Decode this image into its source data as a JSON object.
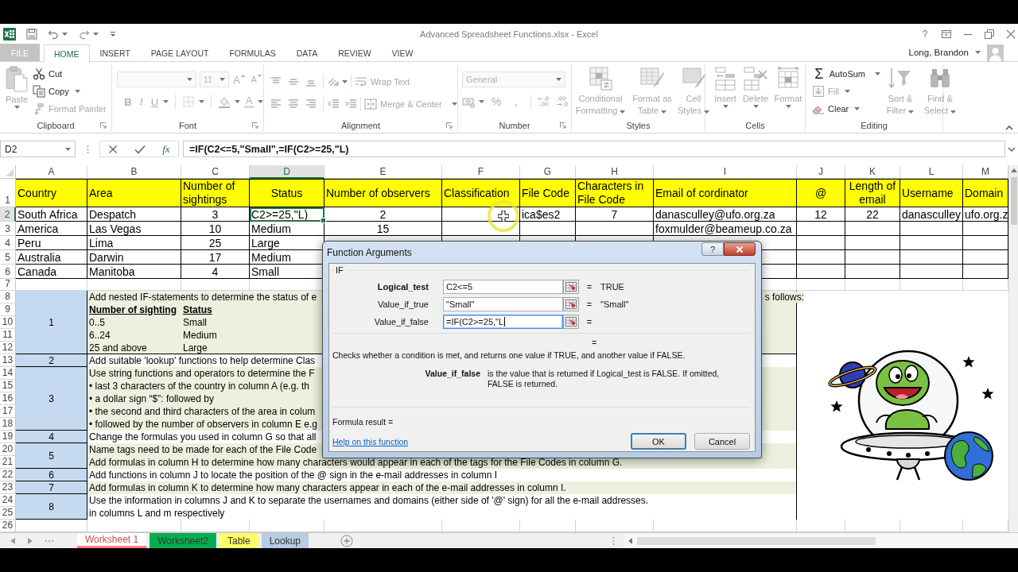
{
  "window": {
    "title": "Advanced Spreadsheet Functions.xlsx - Excel",
    "help": "?",
    "user": "Long, Brandon"
  },
  "ribbon_tabs": [
    {
      "label": "FILE",
      "kind": "file",
      "selected": false
    },
    {
      "label": "HOME",
      "kind": "tab",
      "selected": true
    },
    {
      "label": "INSERT",
      "kind": "tab",
      "selected": false
    },
    {
      "label": "PAGE LAYOUT",
      "kind": "tab",
      "selected": false
    },
    {
      "label": "FORMULAS",
      "kind": "tab",
      "selected": false
    },
    {
      "label": "DATA",
      "kind": "tab",
      "selected": false
    },
    {
      "label": "REVIEW",
      "kind": "tab",
      "selected": false
    },
    {
      "label": "VIEW",
      "kind": "tab",
      "selected": false
    }
  ],
  "ribbon_groups": [
    {
      "label": "Clipboard",
      "commands": [
        {
          "label": "Paste",
          "disabled": true
        },
        {
          "label": "Cut",
          "disabled": false
        },
        {
          "label": "Copy",
          "disabled": false
        },
        {
          "label": "Format Painter",
          "disabled": true
        }
      ]
    },
    {
      "label": "Font",
      "disabled": true,
      "font_size": "11",
      "letter_buttons": [
        {
          "kind": "grow",
          "label": "A"
        },
        {
          "kind": "shrink",
          "label": "A"
        },
        {
          "kind": "bold",
          "label": "B"
        },
        {
          "kind": "italic",
          "label": "I"
        },
        {
          "kind": "underline",
          "label": "U"
        },
        {
          "kind": "color",
          "label": "A"
        }
      ]
    },
    {
      "label": "Alignment",
      "disabled": true,
      "commands": [
        {
          "label": "Wrap Text",
          "disabled": true
        },
        {
          "label": "Merge & Center",
          "disabled": true
        }
      ]
    },
    {
      "label": "Number",
      "disabled": true,
      "format": "General",
      "symbols": [
        "%",
        ","
      ]
    },
    {
      "label": "Styles",
      "commands": [
        {
          "label": "Conditional Formatting",
          "disabled": true
        },
        {
          "label": "Format as Table",
          "disabled": true
        },
        {
          "label": "Cell Styles",
          "disabled": true
        }
      ]
    },
    {
      "label": "Cells",
      "commands": [
        {
          "label": "Insert",
          "disabled": true
        },
        {
          "label": "Delete",
          "disabled": true
        },
        {
          "label": "Format",
          "disabled": true
        }
      ]
    },
    {
      "label": "Editing",
      "commands": [
        {
          "label": "AutoSum",
          "symbol": "Σ",
          "disabled": false
        },
        {
          "label": "Fill",
          "disabled": true
        },
        {
          "label": "Clear",
          "disabled": false
        },
        {
          "label": "Sort & Filter",
          "disabled": true
        },
        {
          "label": "Find & Select",
          "disabled": true
        }
      ]
    }
  ],
  "formula_bar": {
    "name_box": "D2",
    "function_button": "fx",
    "formula": "=IF(C2<=5,\"Small\",=IF(C2>=25,\"L)"
  },
  "columns": [
    {
      "label": "A",
      "selected": false
    },
    {
      "label": "B",
      "selected": false
    },
    {
      "label": "C",
      "selected": false
    },
    {
      "label": "D",
      "selected": true
    },
    {
      "label": "E",
      "selected": false
    },
    {
      "label": "F",
      "selected": false
    },
    {
      "label": "G",
      "selected": false
    },
    {
      "label": "H",
      "selected": false
    },
    {
      "label": "I",
      "selected": false
    },
    {
      "label": "J",
      "selected": false
    },
    {
      "label": "K",
      "selected": false
    },
    {
      "label": "L",
      "selected": false
    },
    {
      "label": "M",
      "selected": false
    }
  ],
  "row_numbers": [
    {
      "label": "1",
      "selected": false
    },
    {
      "label": "2",
      "selected": true
    },
    {
      "label": "3",
      "selected": false
    },
    {
      "label": "4",
      "selected": false
    },
    {
      "label": "5",
      "selected": false
    },
    {
      "label": "6",
      "selected": false
    },
    {
      "label": "7",
      "selected": false
    },
    {
      "label": "8",
      "selected": false
    },
    {
      "label": "9",
      "selected": false
    },
    {
      "label": "10",
      "selected": false
    },
    {
      "label": "11",
      "selected": false
    },
    {
      "label": "12",
      "selected": false
    },
    {
      "label": "13",
      "selected": false
    },
    {
      "label": "14",
      "selected": false
    },
    {
      "label": "15",
      "selected": false
    },
    {
      "label": "16",
      "selected": false
    },
    {
      "label": "17",
      "selected": false
    },
    {
      "label": "18",
      "selected": false
    },
    {
      "label": "19",
      "selected": false
    },
    {
      "label": "20",
      "selected": false
    },
    {
      "label": "21",
      "selected": false
    },
    {
      "label": "22",
      "selected": false
    },
    {
      "label": "23",
      "selected": false
    },
    {
      "label": "24",
      "selected": false
    },
    {
      "label": "25",
      "selected": false
    },
    {
      "label": "26",
      "selected": false
    }
  ],
  "rows": [
    {
      "kind": "header",
      "cells": [
        "Country",
        "Area",
        "Number of sightings",
        "Status",
        "Number of observers",
        "Classification",
        "File Code",
        "Characters in File Code",
        "Email of cordinator",
        "@",
        "Length of email",
        "Username",
        "Domain"
      ]
    },
    {
      "kind": "data",
      "cells": [
        "South Africa",
        "Despatch",
        "3",
        "C2>=25,\"L)",
        "2",
        null,
        "ica$es2",
        "7",
        "danasculley@ufo.org.za",
        "12",
        "22",
        "danasculley",
        "ufo.org.z"
      ]
    },
    {
      "kind": "data",
      "cells": [
        "America",
        "Las Vegas",
        "10",
        "Medium",
        "15",
        null,
        null,
        null,
        "foxmulder@beameup.co.za",
        null,
        null,
        null,
        null
      ]
    },
    {
      "kind": "data",
      "cells": [
        "Peru",
        "Lima",
        "25",
        "Large",
        null,
        null,
        null,
        null,
        null,
        null,
        null,
        null,
        null
      ]
    },
    {
      "kind": "data",
      "cells": [
        "Australia",
        "Darwin",
        "17",
        "Medium",
        null,
        null,
        null,
        null,
        null,
        null,
        null,
        null,
        null
      ]
    },
    {
      "kind": "data",
      "cells": [
        "Canada",
        "Manitoba",
        "4",
        "Small",
        null,
        null,
        null,
        null,
        null,
        null,
        null,
        null,
        null
      ]
    }
  ],
  "tasks": [
    {
      "number": "1",
      "lines": [
        {
          "kind": "text",
          "text": "Add nested IF-statements to determine the status of e",
          "end": "s follows:"
        },
        {
          "kind": "table_head",
          "cells": [
            "Number of sighting",
            "Status"
          ]
        },
        {
          "kind": "table_row",
          "cells": [
            "0..5",
            "Small"
          ]
        },
        {
          "kind": "table_row",
          "cells": [
            "6..24",
            "Medium"
          ]
        },
        {
          "kind": "table_row",
          "cells": [
            "25 and above",
            "Large"
          ]
        }
      ]
    },
    {
      "number": "2",
      "lines": [
        {
          "kind": "text",
          "text": "Add suitable 'lookup' functions to help determine Clas"
        }
      ]
    },
    {
      "number": "3",
      "lines": [
        {
          "kind": "text",
          "text": "Use string functions and operators to determine the F"
        },
        {
          "kind": "text",
          "text": "• last 3 characters of the country in column A (e.g. th"
        },
        {
          "kind": "text",
          "text": "• a dollar sign “$”: followed by"
        },
        {
          "kind": "text",
          "text": "• the second and third characters of the area in colum"
        },
        {
          "kind": "text",
          "text": "• followed by the number of observers in column E e.g"
        }
      ]
    },
    {
      "number": "4",
      "lines": [
        {
          "kind": "text",
          "text": "Change the formulas you used in column G so that all"
        }
      ]
    },
    {
      "number": "5",
      "lines": [
        {
          "kind": "text",
          "text": "Name tags need to be made for each of the File Code"
        },
        {
          "kind": "text",
          "text": "Add formulas in column H to determine how many characters would appear in each of the tags for the File Codes in column G."
        }
      ]
    },
    {
      "number": "6",
      "lines": [
        {
          "kind": "text",
          "text": "Add functions in column J to locate the position of the @ sign in the e-mail addresses in column I"
        }
      ]
    },
    {
      "number": "7",
      "lines": [
        {
          "kind": "text",
          "text": "Add formulas in column K to determine how many characters appear in each of the e-mail addresses in column I."
        }
      ]
    },
    {
      "number": "8",
      "lines": [
        {
          "kind": "text",
          "text": "Use the information in columns J and K to separate the usernames and domains (either side of '@' sign) for all the e-mail addresses."
        },
        {
          "kind": "text",
          "text": "in columns L and m respectively"
        }
      ]
    }
  ],
  "sheet_tabs": [
    {
      "label": "Worksheet 1",
      "selected": true,
      "color": "#ff7c80"
    },
    {
      "label": "Worksheet2",
      "selected": false,
      "color": "#00b050"
    },
    {
      "label": "Table",
      "selected": false,
      "color": "#ffff66"
    },
    {
      "label": "Lookup",
      "selected": false,
      "color": "#b8cce4"
    }
  ],
  "dialog": {
    "title": "Function Arguments",
    "help_button": "?",
    "function": "IF",
    "arguments": [
      {
        "name": "Logical_test",
        "required": true,
        "value": "C2<=5",
        "sign": "=",
        "result": "TRUE",
        "focused": false
      },
      {
        "name": "Value_if_true",
        "required": false,
        "value": "\"Small\"",
        "sign": "=",
        "result": "\"Small\"",
        "focused": false
      },
      {
        "name": "Value_if_false",
        "required": false,
        "value": "=IF(C2>=25,\"L",
        "sign": "=",
        "focused": true
      }
    ],
    "result_sign": "=",
    "description": "Checks whether a condition is met, and returns one value if TRUE, and another value if FALSE.",
    "argument_help": {
      "name": "Value_if_false",
      "text": "is the value that is returned if Logical_test is FALSE. If omitted, FALSE is returned."
    },
    "formula_result": "Formula result =",
    "help_link": "Help on this function",
    "buttons": [
      {
        "label": "OK",
        "default": true
      },
      {
        "label": "Cancel",
        "default": false
      }
    ]
  }
}
